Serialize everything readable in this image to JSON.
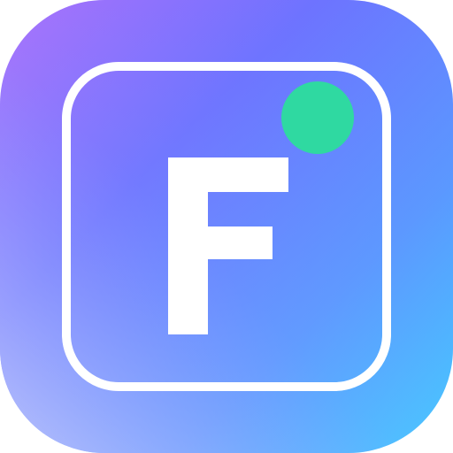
{
  "app_icon": {
    "letter": "F",
    "icon": "letter-f-app-icon",
    "colors": {
      "gradient_start": "#a46dfb",
      "gradient_mid": "#5c72ff",
      "gradient_end": "#3fcfff",
      "glyph": "#ffffff",
      "frame": "#ffffff",
      "status_dot": "#2fd9a1"
    }
  }
}
